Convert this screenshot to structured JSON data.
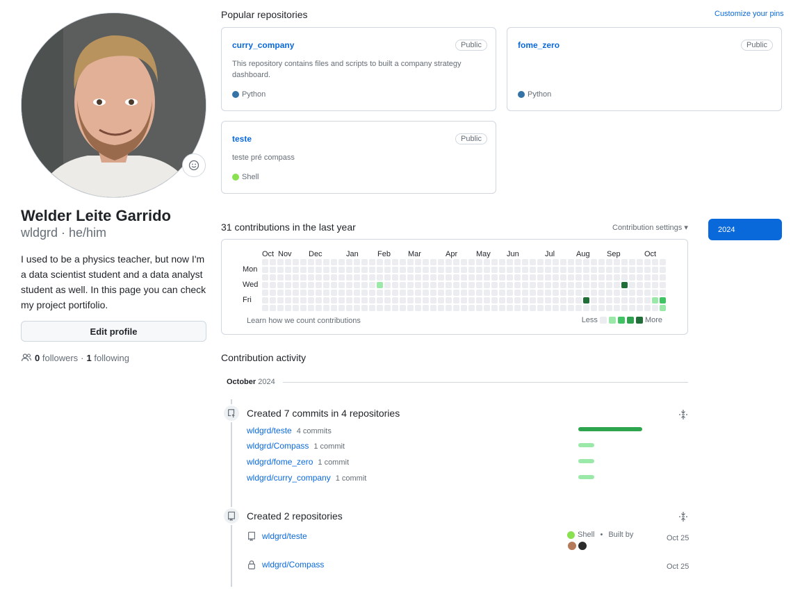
{
  "profile": {
    "name": "Welder Leite Garrido",
    "login_pronouns": "wldgrd · he/him",
    "bio": "I used to be a physics teacher, but now I'm a data scientist student and a data analyst student as well. In this page you can check my project portifolio.",
    "edit_label": "Edit profile",
    "followers_count": "0",
    "followers_label": "followers",
    "sep": "·",
    "following_count": "1",
    "following_label": "following"
  },
  "pins": {
    "title": "Popular repositories",
    "customize_label": "Customize your pins",
    "repos": [
      {
        "name": "curry_company",
        "visibility": "Public",
        "description": "This repository contains files and scripts to built a company strategy dashboard.",
        "language": "Python",
        "language_color": "#3572A5"
      },
      {
        "name": "fome_zero",
        "visibility": "Public",
        "description": "",
        "language": "Python",
        "language_color": "#3572A5"
      },
      {
        "name": "teste",
        "visibility": "Public",
        "description": "teste pré compass",
        "language": "Shell",
        "language_color": "#89e051"
      }
    ]
  },
  "contributions": {
    "title": "31 contributions in the last year",
    "settings_label": "Contribution settings ▾",
    "year": "2024",
    "months": [
      "Oct",
      "Nov",
      "Dec",
      "Jan",
      "Feb",
      "Mar",
      "Apr",
      "May",
      "Jun",
      "Jul",
      "Aug",
      "Sep",
      "Oct"
    ],
    "days": [
      "Mon",
      "Wed",
      "Fri"
    ],
    "learn_label": "Learn how we count contributions",
    "less_label": "Less",
    "more_label": "More",
    "level_colors": [
      "#ebedf0",
      "#9be9a8",
      "#40c463",
      "#30a14e",
      "#216e39"
    ],
    "weeks": 53,
    "active_cells": [
      {
        "week": 15,
        "day": 3,
        "level": 1
      },
      {
        "week": 47,
        "day": 3,
        "level": 4
      },
      {
        "week": 42,
        "day": 5,
        "level": 4
      },
      {
        "week": 51,
        "day": 5,
        "level": 1
      },
      {
        "week": 52,
        "day": 5,
        "level": 2
      },
      {
        "week": 52,
        "day": 6,
        "level": 1
      }
    ]
  },
  "activity": {
    "title": "Contribution activity",
    "month": "October",
    "year": "2024",
    "commits": {
      "title": "Created 7 commits in 4 repositories",
      "rows": [
        {
          "repo": "wldgrd/teste",
          "count": "4 commits",
          "value": 4
        },
        {
          "repo": "wldgrd/Compass",
          "count": "1 commit",
          "value": 1
        },
        {
          "repo": "wldgrd/fome_zero",
          "count": "1 commit",
          "value": 1
        },
        {
          "repo": "wldgrd/curry_company",
          "count": "1 commit",
          "value": 1
        }
      ]
    },
    "repos_created": {
      "title": "Created 2 repositories",
      "rows": [
        {
          "repo": "wldgrd/teste",
          "language": "Shell",
          "built_by": "Built by",
          "date": "Oct 25",
          "icon": "repo-icon"
        },
        {
          "repo": "wldgrd/Compass",
          "date": "Oct 25",
          "icon": "lock-icon"
        }
      ]
    }
  }
}
